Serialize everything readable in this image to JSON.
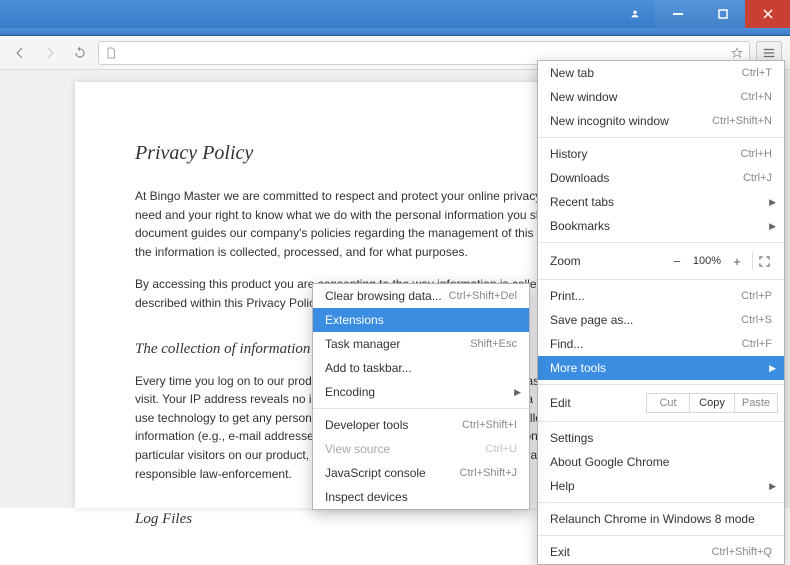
{
  "page": {
    "h1": "Privacy Policy",
    "p1": "At Bingo Master we are committed to respect and protect your online privacy. We recognize your need and your right to know what we do with the personal information you share with us. This document guides our company's policies regarding the management of this data, including how the information is collected, processed, and for what purposes.",
    "p2": "By accessing this product you are consenting to the way information is collected and used, as described within this Privacy Policy.",
    "h2a": "The collection of information",
    "p3": "Every time you log on to our product our servers automatically log some basic data about your visit. Your IP address reveals no information, and it is not linked to you as a person. We do not use technology to get any personal data from your computer, nor do we collect personal information (e.g., e-mail addresses of visitors). Nor do we reveal information to third parties about particular visitors on our product, or (in case of criminal activities) to assist and cooperate with the responsible law-enforcement.",
    "h2b": "Log Files"
  },
  "menu": {
    "newtab": "New tab",
    "newtab_s": "Ctrl+T",
    "newwin": "New window",
    "newwin_s": "Ctrl+N",
    "newinc": "New incognito window",
    "newinc_s": "Ctrl+Shift+N",
    "history": "History",
    "history_s": "Ctrl+H",
    "downloads": "Downloads",
    "downloads_s": "Ctrl+J",
    "recent": "Recent tabs",
    "bookmarks": "Bookmarks",
    "zoom": "Zoom",
    "zoomval": "100%",
    "print": "Print...",
    "print_s": "Ctrl+P",
    "save": "Save page as...",
    "save_s": "Ctrl+S",
    "find": "Find...",
    "find_s": "Ctrl+F",
    "moretools": "More tools",
    "edit": "Edit",
    "cut": "Cut",
    "copy": "Copy",
    "paste": "Paste",
    "settings": "Settings",
    "about": "About Google Chrome",
    "help": "Help",
    "relaunch": "Relaunch Chrome in Windows 8 mode",
    "exit": "Exit",
    "exit_s": "Ctrl+Shift+Q"
  },
  "sub": {
    "clear": "Clear browsing data...",
    "clear_s": "Ctrl+Shift+Del",
    "ext": "Extensions",
    "task": "Task manager",
    "task_s": "Shift+Esc",
    "taskbar": "Add to taskbar...",
    "encoding": "Encoding",
    "devtools": "Developer tools",
    "devtools_s": "Ctrl+Shift+I",
    "viewsrc": "View source",
    "viewsrc_s": "Ctrl+U",
    "jsconsole": "JavaScript console",
    "jsconsole_s": "Ctrl+Shift+J",
    "inspect": "Inspect devices"
  }
}
